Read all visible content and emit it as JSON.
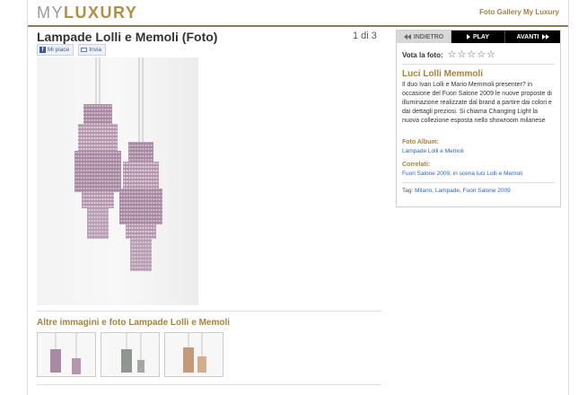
{
  "header": {
    "logo_my": "MY",
    "logo_luxury": "LUXURY",
    "link": "Foto Gallery My Luxury"
  },
  "main": {
    "title": "Lampade Lolli e Memoli (Foto)",
    "counter": "1 di 3",
    "social": {
      "like": "Mi piace",
      "send": "Invia"
    },
    "more_title": "Altre immagini e foto Lampade Lolli e Memoli"
  },
  "sidebar": {
    "nav": {
      "prev": "INDIETRO",
      "play": "PLAY",
      "next": "AVANTI"
    },
    "rate_label": "Vota la foto:",
    "rating": 0,
    "title": "Luci Lolli Memmoli",
    "description": "Il duo Ivan Lolli e Mario Memmoli presenter? in occasione del Fuori Salone 2009 le nuove proposte di illuminazione realizzate dal brand a partire dai colori e dai dettagli preziosi. Si chiama Changing Light la nuova collezione esposta nello showroom milanese",
    "album_label": "Foto Album:",
    "album_link": "Lampade Lolli e Memoli",
    "related_label": "Correlati:",
    "related_link": "Fuori Salone 2009, in scena luci Lolli e Memoli",
    "tags_label": "Tag:",
    "tags": [
      "Milano",
      "Lampade",
      "Fuori Salone 2009"
    ]
  },
  "colors": {
    "accent": "#a6823e",
    "link": "#2a64b5",
    "lamp_pink": "#a98aa3",
    "lamp_gray": "#8f9590",
    "lamp_bronze": "#c49a78"
  }
}
